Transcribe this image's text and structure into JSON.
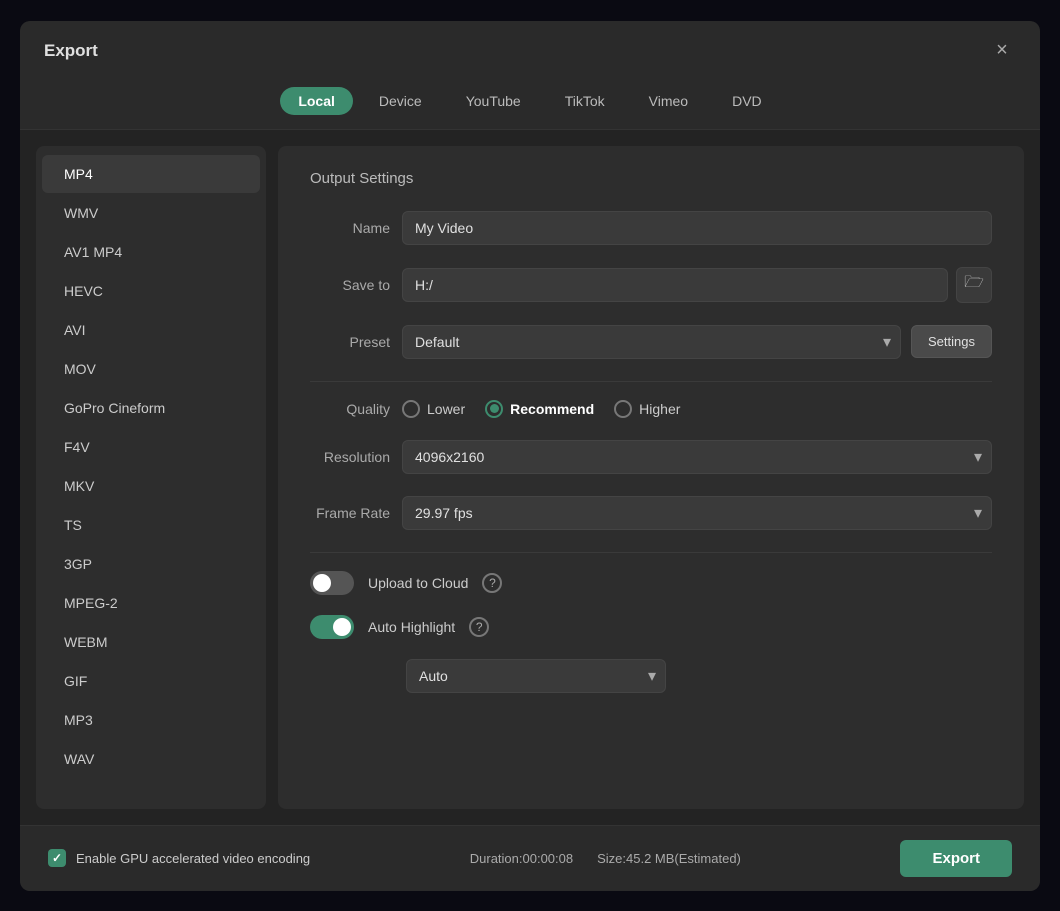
{
  "dialog": {
    "title": "Export",
    "close_label": "×"
  },
  "tabs": {
    "items": [
      {
        "id": "local",
        "label": "Local",
        "active": true
      },
      {
        "id": "device",
        "label": "Device",
        "active": false
      },
      {
        "id": "youtube",
        "label": "YouTube",
        "active": false
      },
      {
        "id": "tiktok",
        "label": "TikTok",
        "active": false
      },
      {
        "id": "vimeo",
        "label": "Vimeo",
        "active": false
      },
      {
        "id": "dvd",
        "label": "DVD",
        "active": false
      }
    ]
  },
  "formats": [
    {
      "id": "mp4",
      "label": "MP4",
      "active": true
    },
    {
      "id": "wmv",
      "label": "WMV",
      "active": false
    },
    {
      "id": "av1mp4",
      "label": "AV1 MP4",
      "active": false
    },
    {
      "id": "hevc",
      "label": "HEVC",
      "active": false
    },
    {
      "id": "avi",
      "label": "AVI",
      "active": false
    },
    {
      "id": "mov",
      "label": "MOV",
      "active": false
    },
    {
      "id": "gopro",
      "label": "GoPro Cineform",
      "active": false
    },
    {
      "id": "f4v",
      "label": "F4V",
      "active": false
    },
    {
      "id": "mkv",
      "label": "MKV",
      "active": false
    },
    {
      "id": "ts",
      "label": "TS",
      "active": false
    },
    {
      "id": "3gp",
      "label": "3GP",
      "active": false
    },
    {
      "id": "mpeg2",
      "label": "MPEG-2",
      "active": false
    },
    {
      "id": "webm",
      "label": "WEBM",
      "active": false
    },
    {
      "id": "gif",
      "label": "GIF",
      "active": false
    },
    {
      "id": "mp3",
      "label": "MP3",
      "active": false
    },
    {
      "id": "wav",
      "label": "WAV",
      "active": false
    }
  ],
  "settings": {
    "section_title": "Output Settings",
    "name_label": "Name",
    "name_value": "My Video",
    "save_to_label": "Save to",
    "save_to_value": "H:/",
    "preset_label": "Preset",
    "preset_value": "Default",
    "settings_btn": "Settings",
    "quality_label": "Quality",
    "quality_options": [
      {
        "id": "lower",
        "label": "Lower",
        "selected": false
      },
      {
        "id": "recommend",
        "label": "Recommend",
        "selected": true
      },
      {
        "id": "higher",
        "label": "Higher",
        "selected": false
      }
    ],
    "resolution_label": "Resolution",
    "resolution_value": "4096x2160",
    "frame_rate_label": "Frame Rate",
    "frame_rate_value": "29.97 fps",
    "upload_cloud_label": "Upload to Cloud",
    "upload_cloud_on": false,
    "auto_highlight_label": "Auto Highlight",
    "auto_highlight_on": true,
    "auto_highlight_dropdown": "Auto"
  },
  "footer": {
    "gpu_label": "Enable GPU accelerated video encoding",
    "duration_label": "Duration:00:00:08",
    "size_label": "Size:45.2 MB(Estimated)",
    "export_label": "Export"
  }
}
